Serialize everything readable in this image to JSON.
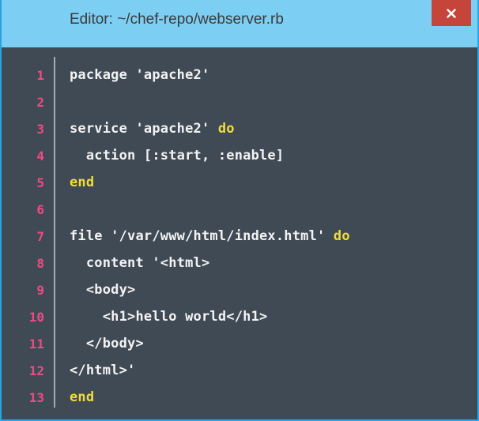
{
  "window": {
    "title": "Editor: ~/chef-repo/webserver.rb",
    "close_icon": "close-icon",
    "colors": {
      "titlebar": "#7ccef2",
      "close_button": "#c5453a",
      "editor_background": "#3f4a55",
      "line_number": "#ee4b85",
      "keyword": "#f2dc3b",
      "code_text": "#f3f3f3"
    }
  },
  "editor": {
    "lines": [
      {
        "number": "1",
        "code": "package 'apache2'",
        "keyword": ""
      },
      {
        "number": "2",
        "code": "",
        "keyword": ""
      },
      {
        "number": "3",
        "code": "service 'apache2' ",
        "keyword": "do"
      },
      {
        "number": "4",
        "code": "  action [:start, :enable]",
        "keyword": ""
      },
      {
        "number": "5",
        "code": "",
        "keyword": "end"
      },
      {
        "number": "6",
        "code": "",
        "keyword": ""
      },
      {
        "number": "7",
        "code": "file '/var/www/html/index.html' ",
        "keyword": "do"
      },
      {
        "number": "8",
        "code": "  content '<html>",
        "keyword": ""
      },
      {
        "number": "9",
        "code": "  <body>",
        "keyword": ""
      },
      {
        "number": "10",
        "code": "    <h1>hello world</h1>",
        "keyword": ""
      },
      {
        "number": "11",
        "code": "  </body>",
        "keyword": ""
      },
      {
        "number": "12",
        "code": "</html>'",
        "keyword": ""
      },
      {
        "number": "13",
        "code": "",
        "keyword": "end"
      }
    ]
  }
}
